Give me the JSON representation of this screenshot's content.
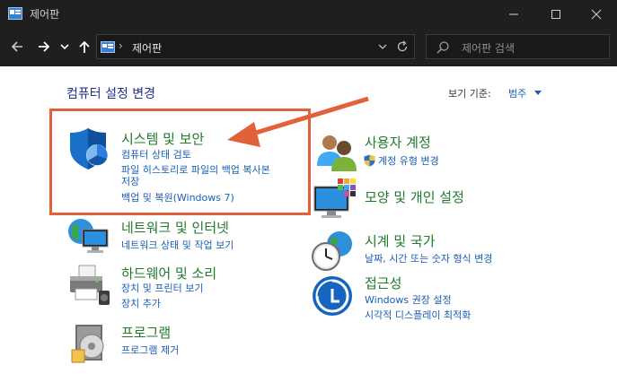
{
  "window": {
    "title": "제어판"
  },
  "address_bar": {
    "path": "제어판"
  },
  "search": {
    "placeholder": "제어판 검색"
  },
  "main": {
    "page_title": "컴퓨터 설정 변경",
    "view_by_label": "보기 기준:",
    "view_by_value": "범주"
  },
  "categories": {
    "system": {
      "title": "시스템 및 보안",
      "links": [
        "컴퓨터 상태 검토",
        "파일 히스토리로 파일의 백업 복사본",
        "저장",
        "백업 및 복원(Windows 7)"
      ]
    },
    "network": {
      "title": "네트워크 및 인터넷",
      "links": [
        "네트워크 상태 및 작업 보기"
      ]
    },
    "hardware": {
      "title": "하드웨어 및 소리",
      "links": [
        "장치 및 프린터 보기",
        "장치 추가"
      ]
    },
    "programs": {
      "title": "프로그램",
      "links": [
        "프로그램 제거"
      ]
    },
    "users": {
      "title": "사용자 계정",
      "links": [
        "계정 유형 변경"
      ]
    },
    "appearance": {
      "title": "모양 및 개인 설정",
      "links": []
    },
    "clock": {
      "title": "시계 및 국가",
      "links": [
        "날짜, 시간 또는 숫자 형식 변경"
      ]
    },
    "ease": {
      "title": "접근성",
      "links": [
        "Windows 권장 설정",
        "시각적 디스플레이 최적화"
      ]
    }
  },
  "colors": {
    "titlebar_bg": "#1f1f1f",
    "category_title": "#207a2b",
    "link": "#1a5fb4",
    "highlight": "#e2603a"
  },
  "icons": [
    "control-panel-icon",
    "back-arrow-icon",
    "forward-arrow-icon",
    "recent-chevron-icon",
    "up-arrow-icon",
    "chevron-down-icon",
    "refresh-icon",
    "search-icon",
    "minimize-icon",
    "maximize-icon",
    "close-icon",
    "shield-icon",
    "users-icon",
    "uac-shield-icon",
    "network-icon",
    "appearance-icon",
    "printer-icon",
    "clock-globe-icon",
    "programs-icon",
    "ease-of-access-icon"
  ]
}
